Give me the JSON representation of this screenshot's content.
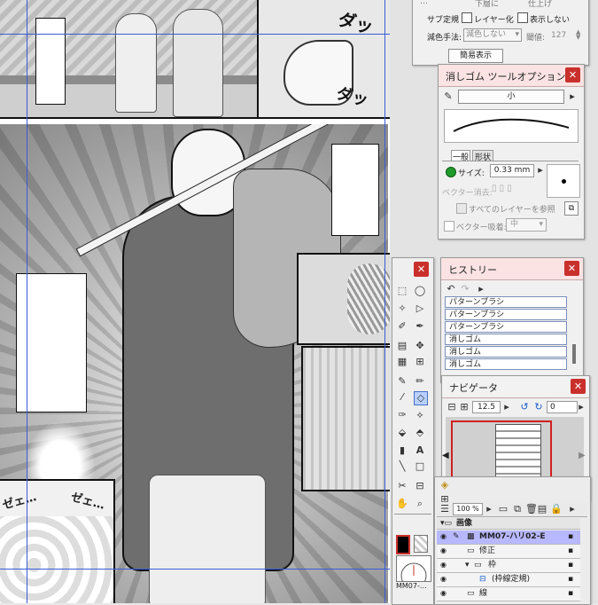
{
  "top_panel": {
    "partial_radio_a": "…",
    "partial_radio_b": "下層に",
    "partial_radio_c": "仕上げ",
    "sub_ruler_label": "サブ定規",
    "layer_option": "レイヤー化",
    "hide_option": "表示しない",
    "subtract_method_label": "減色手法:",
    "subtract_method_value": "減色しない",
    "threshold_label": "閾値:",
    "threshold_value": "127",
    "simple_display": "簡易表示"
  },
  "eraser_palette": {
    "title": "消しゴム ツールオプション",
    "preset": "小",
    "tab_general": "一般",
    "tab_shape": "形状",
    "size_label": "サイズ:",
    "size_value": "0.33 mm",
    "vector_erase_label": "ベクター消去:",
    "all_layers_label": "すべてのレイヤーを参照",
    "vector_snap_label": "ベクター吸着:",
    "vector_snap_value": "中"
  },
  "history_palette": {
    "title": "ヒストリー",
    "items": [
      "パターンブラシ",
      "パターンブラシ",
      "パターンブラシ",
      "消しゴム",
      "消しゴム",
      "消しゴム"
    ]
  },
  "navigator_palette": {
    "title": "ナビゲータ",
    "zoom": "12.5",
    "rotation": "0"
  },
  "layer_palette": {
    "opacity": "100 %",
    "root_name": "画像",
    "layers": [
      {
        "name": "MM07-ハリ02-E",
        "selected": true
      },
      {
        "name": "修正",
        "selected": false
      },
      {
        "name": "枠",
        "selected": false
      },
      {
        "name": "(枠線定規)",
        "selected": false
      },
      {
        "name": "線",
        "selected": false
      }
    ]
  },
  "tool_palette": {
    "thumbnail_label": "MM07-…"
  },
  "sfx": {
    "top_sound": "ダッ",
    "top_sound_2": "ダッ",
    "bottom_left": "ゼェ…",
    "bottom_right": "ゼェ…"
  },
  "colors": {
    "guide_blue": "#3a5bd9",
    "title_pink": "#fbe3e3",
    "close_red": "#c9302c",
    "selected_layer": "#b8b8ff"
  }
}
